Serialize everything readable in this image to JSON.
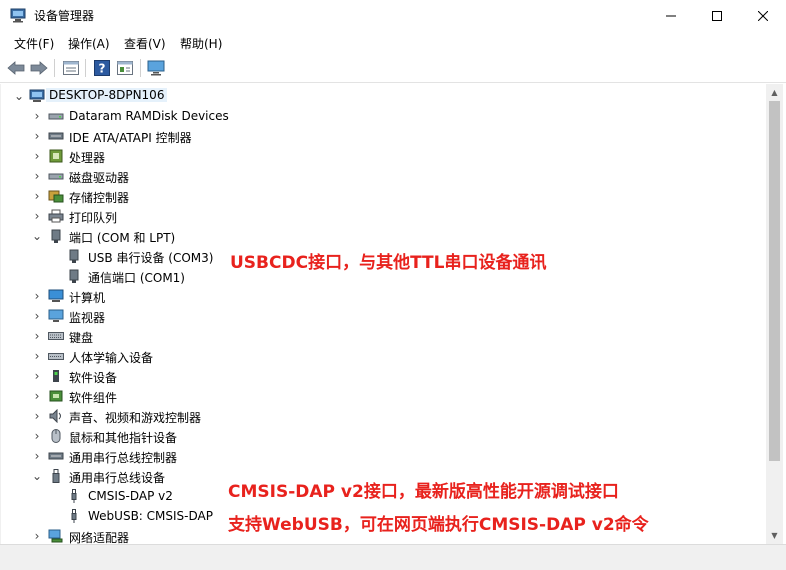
{
  "window": {
    "title": "设备管理器",
    "icon": "device-manager-icon",
    "controls": {
      "minimize": "—",
      "maximize": "☐",
      "close": "✕"
    }
  },
  "menu": {
    "items": [
      "文件(F)",
      "操作(A)",
      "查看(V)",
      "帮助(H)"
    ]
  },
  "toolbar": {
    "buttons": [
      "back-icon",
      "forward-icon",
      "properties-icon",
      "help-icon",
      "driver-icon",
      "monitor-icon"
    ]
  },
  "tree": {
    "root": "DESKTOP-8DPN106",
    "rows": [
      {
        "label": "Dataram RAMDisk Devices",
        "icon": "disk-icon",
        "expanded": false
      },
      {
        "label": "IDE ATA/ATAPI 控制器",
        "icon": "ide-controller-icon",
        "expanded": false
      },
      {
        "label": "处理器",
        "icon": "cpu-icon",
        "expanded": false
      },
      {
        "label": "磁盘驱动器",
        "icon": "disk-drive-icon",
        "expanded": false
      },
      {
        "label": "存储控制器",
        "icon": "storage-controller-icon",
        "expanded": false
      },
      {
        "label": "打印队列",
        "icon": "printer-icon",
        "expanded": false
      },
      {
        "label": "端口 (COM 和 LPT)",
        "icon": "port-icon",
        "expanded": true
      },
      {
        "label": "USB 串行设备 (COM3)",
        "icon": "port-device-icon",
        "child": true
      },
      {
        "label": "通信端口 (COM1)",
        "icon": "port-device-icon",
        "child": true
      },
      {
        "label": "计算机",
        "icon": "computer-icon",
        "expanded": false
      },
      {
        "label": "监视器",
        "icon": "monitor-icon",
        "expanded": false
      },
      {
        "label": "键盘",
        "icon": "keyboard-icon",
        "expanded": false
      },
      {
        "label": "人体学输入设备",
        "icon": "hid-icon",
        "expanded": false
      },
      {
        "label": "软件设备",
        "icon": "software-device-icon",
        "expanded": false
      },
      {
        "label": "软件组件",
        "icon": "software-component-icon",
        "expanded": false
      },
      {
        "label": "声音、视频和游戏控制器",
        "icon": "sound-icon",
        "expanded": false
      },
      {
        "label": "鼠标和其他指针设备",
        "icon": "mouse-icon",
        "expanded": false
      },
      {
        "label": "通用串行总线控制器",
        "icon": "usb-controller-icon",
        "expanded": false
      },
      {
        "label": "通用串行总线设备",
        "icon": "usb-device-icon",
        "expanded": true
      },
      {
        "label": "CMSIS-DAP v2",
        "icon": "usb-plug-icon",
        "child": true
      },
      {
        "label": "WebUSB: CMSIS-DAP",
        "icon": "usb-plug-icon",
        "child": true
      },
      {
        "label": "网络适配器",
        "icon": "network-icon",
        "expanded": false
      }
    ]
  },
  "annotations": {
    "usbcdc": "USBCDC接口，与其他TTL串口设备通讯",
    "cmsis_dap_v2": "CMSIS-DAP v2接口，最新版高性能开源调试接口",
    "webusb": "支持WebUSB，可在网页端执行CMSIS-DAP v2命令"
  },
  "colors": {
    "annotation": "#e8221d",
    "selection": "#e5f1fb"
  }
}
